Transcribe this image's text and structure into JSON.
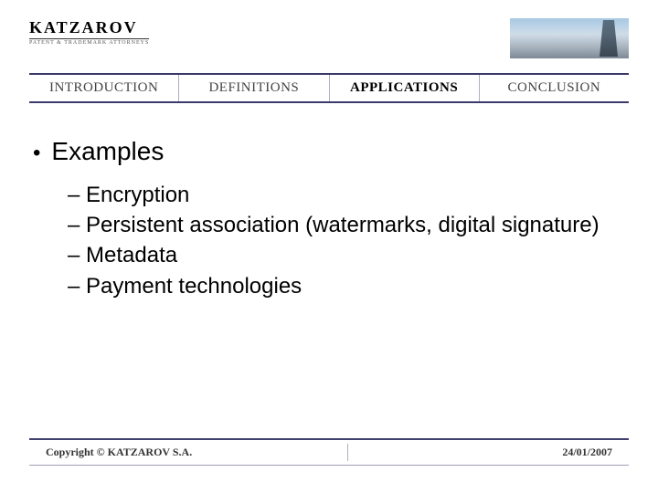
{
  "header": {
    "logo_text": "KATZAROV",
    "logo_sub": "PATENT & TRADEMARK ATTORNEYS"
  },
  "nav": {
    "items": [
      {
        "label": "INTRODUCTION",
        "active": false
      },
      {
        "label": "DEFINITIONS",
        "active": false
      },
      {
        "label": "APPLICATIONS",
        "active": true
      },
      {
        "label": "CONCLUSION",
        "active": false
      }
    ]
  },
  "content": {
    "heading": "Examples",
    "items": [
      "Encryption",
      "Persistent association (watermarks, digital signature)",
      "Metadata",
      "Payment technologies"
    ]
  },
  "footer": {
    "copyright": "Copyright © KATZAROV S.A.",
    "date": "24/01/2007"
  }
}
